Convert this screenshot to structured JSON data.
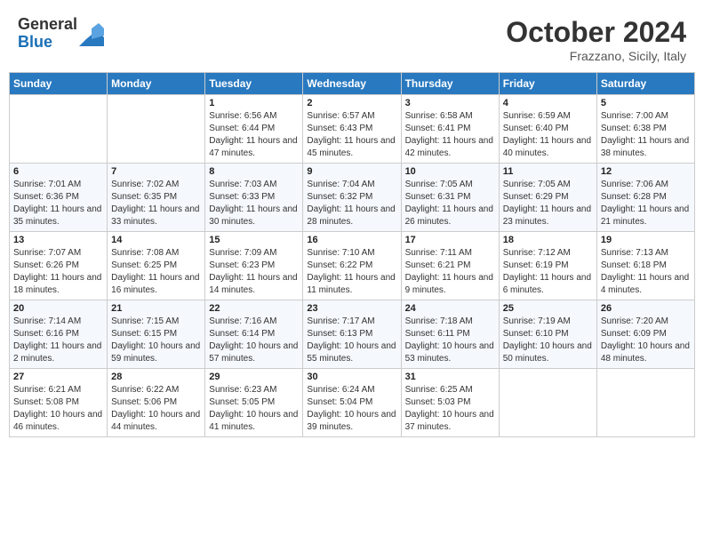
{
  "header": {
    "logo_line1": "General",
    "logo_line2": "Blue",
    "month": "October 2024",
    "location": "Frazzano, Sicily, Italy"
  },
  "weekdays": [
    "Sunday",
    "Monday",
    "Tuesday",
    "Wednesday",
    "Thursday",
    "Friday",
    "Saturday"
  ],
  "weeks": [
    [
      {
        "day": "",
        "sunrise": "",
        "sunset": "",
        "daylight": ""
      },
      {
        "day": "",
        "sunrise": "",
        "sunset": "",
        "daylight": ""
      },
      {
        "day": "1",
        "sunrise": "Sunrise: 6:56 AM",
        "sunset": "Sunset: 6:44 PM",
        "daylight": "Daylight: 11 hours and 47 minutes."
      },
      {
        "day": "2",
        "sunrise": "Sunrise: 6:57 AM",
        "sunset": "Sunset: 6:43 PM",
        "daylight": "Daylight: 11 hours and 45 minutes."
      },
      {
        "day": "3",
        "sunrise": "Sunrise: 6:58 AM",
        "sunset": "Sunset: 6:41 PM",
        "daylight": "Daylight: 11 hours and 42 minutes."
      },
      {
        "day": "4",
        "sunrise": "Sunrise: 6:59 AM",
        "sunset": "Sunset: 6:40 PM",
        "daylight": "Daylight: 11 hours and 40 minutes."
      },
      {
        "day": "5",
        "sunrise": "Sunrise: 7:00 AM",
        "sunset": "Sunset: 6:38 PM",
        "daylight": "Daylight: 11 hours and 38 minutes."
      }
    ],
    [
      {
        "day": "6",
        "sunrise": "Sunrise: 7:01 AM",
        "sunset": "Sunset: 6:36 PM",
        "daylight": "Daylight: 11 hours and 35 minutes."
      },
      {
        "day": "7",
        "sunrise": "Sunrise: 7:02 AM",
        "sunset": "Sunset: 6:35 PM",
        "daylight": "Daylight: 11 hours and 33 minutes."
      },
      {
        "day": "8",
        "sunrise": "Sunrise: 7:03 AM",
        "sunset": "Sunset: 6:33 PM",
        "daylight": "Daylight: 11 hours and 30 minutes."
      },
      {
        "day": "9",
        "sunrise": "Sunrise: 7:04 AM",
        "sunset": "Sunset: 6:32 PM",
        "daylight": "Daylight: 11 hours and 28 minutes."
      },
      {
        "day": "10",
        "sunrise": "Sunrise: 7:05 AM",
        "sunset": "Sunset: 6:31 PM",
        "daylight": "Daylight: 11 hours and 26 minutes."
      },
      {
        "day": "11",
        "sunrise": "Sunrise: 7:05 AM",
        "sunset": "Sunset: 6:29 PM",
        "daylight": "Daylight: 11 hours and 23 minutes."
      },
      {
        "day": "12",
        "sunrise": "Sunrise: 7:06 AM",
        "sunset": "Sunset: 6:28 PM",
        "daylight": "Daylight: 11 hours and 21 minutes."
      }
    ],
    [
      {
        "day": "13",
        "sunrise": "Sunrise: 7:07 AM",
        "sunset": "Sunset: 6:26 PM",
        "daylight": "Daylight: 11 hours and 18 minutes."
      },
      {
        "day": "14",
        "sunrise": "Sunrise: 7:08 AM",
        "sunset": "Sunset: 6:25 PM",
        "daylight": "Daylight: 11 hours and 16 minutes."
      },
      {
        "day": "15",
        "sunrise": "Sunrise: 7:09 AM",
        "sunset": "Sunset: 6:23 PM",
        "daylight": "Daylight: 11 hours and 14 minutes."
      },
      {
        "day": "16",
        "sunrise": "Sunrise: 7:10 AM",
        "sunset": "Sunset: 6:22 PM",
        "daylight": "Daylight: 11 hours and 11 minutes."
      },
      {
        "day": "17",
        "sunrise": "Sunrise: 7:11 AM",
        "sunset": "Sunset: 6:21 PM",
        "daylight": "Daylight: 11 hours and 9 minutes."
      },
      {
        "day": "18",
        "sunrise": "Sunrise: 7:12 AM",
        "sunset": "Sunset: 6:19 PM",
        "daylight": "Daylight: 11 hours and 6 minutes."
      },
      {
        "day": "19",
        "sunrise": "Sunrise: 7:13 AM",
        "sunset": "Sunset: 6:18 PM",
        "daylight": "Daylight: 11 hours and 4 minutes."
      }
    ],
    [
      {
        "day": "20",
        "sunrise": "Sunrise: 7:14 AM",
        "sunset": "Sunset: 6:16 PM",
        "daylight": "Daylight: 11 hours and 2 minutes."
      },
      {
        "day": "21",
        "sunrise": "Sunrise: 7:15 AM",
        "sunset": "Sunset: 6:15 PM",
        "daylight": "Daylight: 10 hours and 59 minutes."
      },
      {
        "day": "22",
        "sunrise": "Sunrise: 7:16 AM",
        "sunset": "Sunset: 6:14 PM",
        "daylight": "Daylight: 10 hours and 57 minutes."
      },
      {
        "day": "23",
        "sunrise": "Sunrise: 7:17 AM",
        "sunset": "Sunset: 6:13 PM",
        "daylight": "Daylight: 10 hours and 55 minutes."
      },
      {
        "day": "24",
        "sunrise": "Sunrise: 7:18 AM",
        "sunset": "Sunset: 6:11 PM",
        "daylight": "Daylight: 10 hours and 53 minutes."
      },
      {
        "day": "25",
        "sunrise": "Sunrise: 7:19 AM",
        "sunset": "Sunset: 6:10 PM",
        "daylight": "Daylight: 10 hours and 50 minutes."
      },
      {
        "day": "26",
        "sunrise": "Sunrise: 7:20 AM",
        "sunset": "Sunset: 6:09 PM",
        "daylight": "Daylight: 10 hours and 48 minutes."
      }
    ],
    [
      {
        "day": "27",
        "sunrise": "Sunrise: 6:21 AM",
        "sunset": "Sunset: 5:08 PM",
        "daylight": "Daylight: 10 hours and 46 minutes."
      },
      {
        "day": "28",
        "sunrise": "Sunrise: 6:22 AM",
        "sunset": "Sunset: 5:06 PM",
        "daylight": "Daylight: 10 hours and 44 minutes."
      },
      {
        "day": "29",
        "sunrise": "Sunrise: 6:23 AM",
        "sunset": "Sunset: 5:05 PM",
        "daylight": "Daylight: 10 hours and 41 minutes."
      },
      {
        "day": "30",
        "sunrise": "Sunrise: 6:24 AM",
        "sunset": "Sunset: 5:04 PM",
        "daylight": "Daylight: 10 hours and 39 minutes."
      },
      {
        "day": "31",
        "sunrise": "Sunrise: 6:25 AM",
        "sunset": "Sunset: 5:03 PM",
        "daylight": "Daylight: 10 hours and 37 minutes."
      },
      {
        "day": "",
        "sunrise": "",
        "sunset": "",
        "daylight": ""
      },
      {
        "day": "",
        "sunrise": "",
        "sunset": "",
        "daylight": ""
      }
    ]
  ]
}
